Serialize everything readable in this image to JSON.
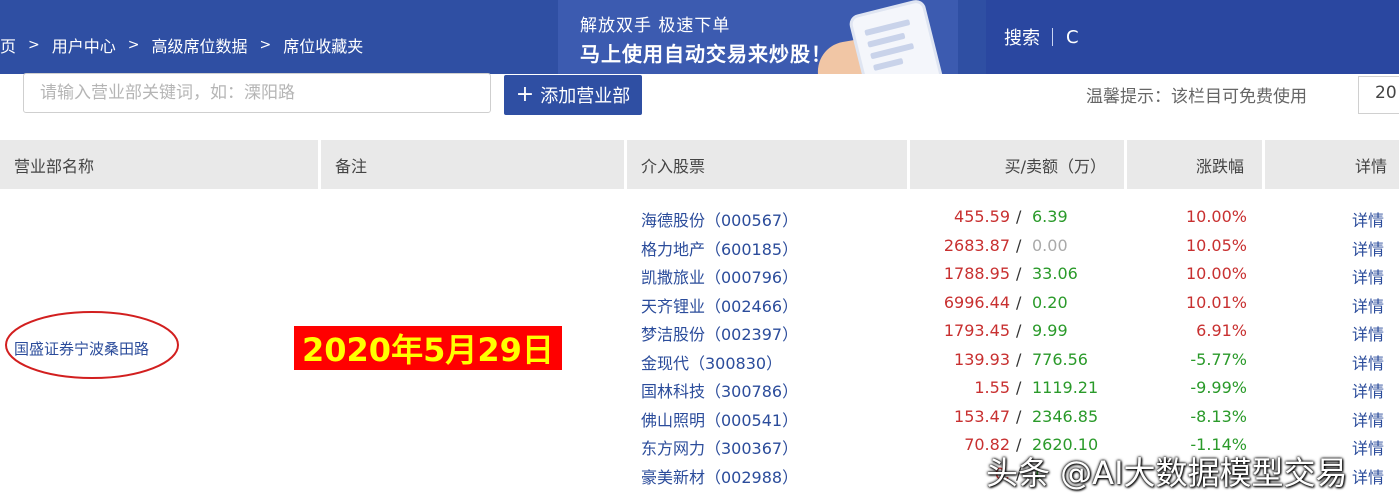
{
  "breadcrumb": [
    "页",
    "用户中心",
    "高级席位数据",
    "席位收藏夹"
  ],
  "banner": {
    "line1": "解放双手  极速下单",
    "line2": "马上使用自动交易来炒股！"
  },
  "search": {
    "label": "搜索",
    "value": "C"
  },
  "filter": {
    "placeholder": "请输入营业部关键词，如：溧阳路",
    "add_label": "添加营业部",
    "tip": "温馨提示：该栏目可免费使用",
    "page_size": "20"
  },
  "table": {
    "headers": {
      "broker": "营业部名称",
      "note": "备注",
      "stock": "介入股票",
      "amount": "买/卖额（万）",
      "change": "涨跌幅",
      "detail": "详情"
    },
    "broker_name": "国盛证券宁波桑田路",
    "note_stamp": "2020年5月29日",
    "rows": [
      {
        "stock": "海德股份（000567）",
        "buy": "455.59",
        "sell": "6.39",
        "change": "10.00%",
        "detail": "详情"
      },
      {
        "stock": "格力地产（600185）",
        "buy": "2683.87",
        "sell": "0.00",
        "change": "10.05%",
        "detail": "详情"
      },
      {
        "stock": "凯撒旅业（000796）",
        "buy": "1788.95",
        "sell": "33.06",
        "change": "10.00%",
        "detail": "详情"
      },
      {
        "stock": "天齐锂业（002466）",
        "buy": "6996.44",
        "sell": "0.20",
        "change": "10.01%",
        "detail": "详情"
      },
      {
        "stock": "梦洁股份（002397）",
        "buy": "1793.45",
        "sell": "9.99",
        "change": "6.91%",
        "detail": "详情"
      },
      {
        "stock": "金现代（300830）",
        "buy": "139.93",
        "sell": "776.56",
        "change": "-5.77%",
        "detail": "详情"
      },
      {
        "stock": "国林科技（300786）",
        "buy": "1.55",
        "sell": "1119.21",
        "change": "-9.99%",
        "detail": "详情"
      },
      {
        "stock": "佛山照明（000541）",
        "buy": "153.47",
        "sell": "2346.85",
        "change": "-8.13%",
        "detail": "详情"
      },
      {
        "stock": "东方网力（300367）",
        "buy": "70.82",
        "sell": "2620.10",
        "change": "-1.14%",
        "detail": "详情"
      },
      {
        "stock": "豪美新材（002988）",
        "buy": "0.",
        "sell": "1",
        "change": "",
        "detail": "详情"
      }
    ]
  },
  "watermark": "头条 @AI大数据模型交易",
  "colors": {
    "brand": "#2f4fa3",
    "up": "#c83030",
    "down": "#2a9a2a",
    "link": "#2b4c9b",
    "stamp_bg": "#ff0000",
    "stamp_fg": "#ffff00"
  }
}
